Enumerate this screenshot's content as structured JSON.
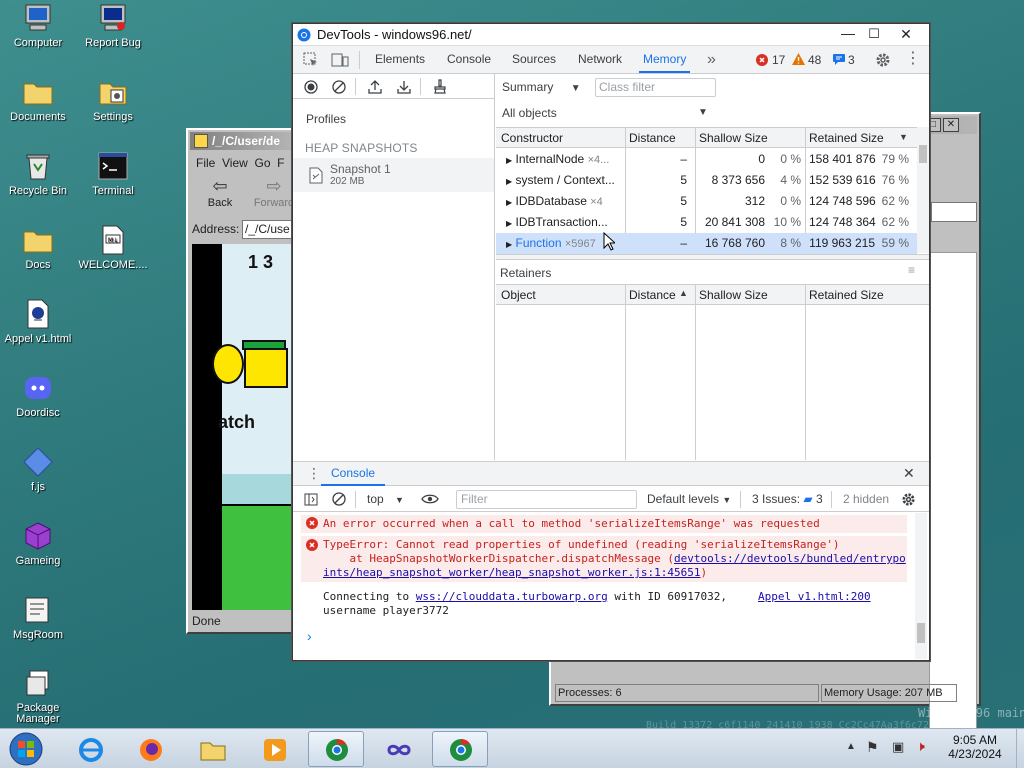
{
  "desktop": {
    "icons": [
      {
        "label": "Computer",
        "icon": "computer-icon"
      },
      {
        "label": "Report Bug",
        "icon": "report-bug-icon"
      },
      {
        "label": "Documents",
        "icon": "folder-icon"
      },
      {
        "label": "Settings",
        "icon": "settings-icon"
      },
      {
        "label": "Recycle Bin",
        "icon": "recycle-bin-icon"
      },
      {
        "label": "Terminal",
        "icon": "terminal-icon"
      },
      {
        "label": "Docs",
        "icon": "folder-icon"
      },
      {
        "label": "WELCOME....",
        "icon": "markdown-file-icon"
      },
      {
        "label": "Appel v1.html",
        "icon": "html-file-icon"
      },
      {
        "label": "Doordisc",
        "icon": "discord-icon"
      },
      {
        "label": "f.js",
        "icon": "js-file-icon"
      },
      {
        "label": "Gameing",
        "icon": "cube-icon"
      },
      {
        "label": "MsgRoom",
        "icon": "msgroom-icon"
      },
      {
        "label": "Package Manager",
        "icon": "package-icon"
      }
    ],
    "watermark": "Windows 96 main",
    "build": "Build 13372 c6f1140 241410 1938 Cc2Cc47Aa3f6c7278"
  },
  "explorer": {
    "title": "/_/C/user/de",
    "menu": [
      "File",
      "View",
      "Go",
      "F"
    ],
    "back_label": "Back",
    "forward_label": "Forward",
    "address_label": "Address:",
    "address_value": "/_/C/use",
    "status": "Done",
    "game_score": "1 3",
    "game_text": "atch"
  },
  "taskmgr": {
    "processes": "Processes: 6",
    "memory": "Memory Usage: 207 MB"
  },
  "devtools": {
    "title": "DevTools - windows96.net/",
    "tabs": [
      "Elements",
      "Console",
      "Sources",
      "Network",
      "Memory"
    ],
    "active_tab": "Memory",
    "errors": "17",
    "warnings": "48",
    "info": "3",
    "profiles_label": "Profiles",
    "heap_section": "HEAP SNAPSHOTS",
    "snapshot_name": "Snapshot 1",
    "snapshot_size": "202 MB",
    "summary_label": "Summary",
    "class_filter_placeholder": "Class filter",
    "all_objects": "All objects",
    "columns": [
      "Constructor",
      "Distance",
      "Shallow Size",
      "Retained Size"
    ],
    "rows": [
      {
        "name": "InternalNode",
        "count": "×4...",
        "distance": "–",
        "shallow": "0",
        "shallow_pct": "0 %",
        "retained": "158 401 876",
        "retained_pct": "79 %"
      },
      {
        "name": "system / Context...",
        "count": "",
        "distance": "5",
        "shallow": "8 373 656",
        "shallow_pct": "4 %",
        "retained": "152 539 616",
        "retained_pct": "76 %"
      },
      {
        "name": "IDBDatabase",
        "count": "×4",
        "distance": "5",
        "shallow": "312",
        "shallow_pct": "0 %",
        "retained": "124 748 596",
        "retained_pct": "62 %"
      },
      {
        "name": "IDBTransaction...",
        "count": "",
        "distance": "5",
        "shallow": "20 841 308",
        "shallow_pct": "10 %",
        "retained": "124 748 364",
        "retained_pct": "62 %"
      },
      {
        "name": "Function",
        "count": "×5967",
        "distance": "–",
        "shallow": "16 768 760",
        "shallow_pct": "8 %",
        "retained": "119 963 215",
        "retained_pct": "59 %"
      }
    ],
    "retainers_label": "Retainers",
    "retainer_columns": [
      "Object",
      "Distance",
      "Shallow Size",
      "Retained Size"
    ],
    "console": {
      "tab_label": "Console",
      "context": "top",
      "filter_placeholder": "Filter",
      "levels": "Default levels",
      "issues_label": "3 Issues:",
      "issues_count": "3",
      "hidden": "2 hidden",
      "messages": {
        "error1": "An error occurred when a call to method 'serializeItemsRange' was requested",
        "error2_line1": "TypeError: Cannot read properties of undefined (reading 'serializeItemsRange')",
        "error2_line2": "    at HeapSnapshotWorkerDispatcher.dispatchMessage (",
        "error2_link": "devtools://devtools/bundled/entrypoints/heap_snapshot_worker/heap_snapshot_worker.js:1:45651",
        "error2_close": ")",
        "info_pre": "Connecting to ",
        "info_link": "wss://clouddata.turbowarp.org",
        "info_post": " with ID 60917032,",
        "info_source": "Appel v1.html:200",
        "info_line2": "username player3772"
      },
      "prompt": "›"
    }
  },
  "taskbar": {
    "time": "9:05 AM",
    "date": "4/23/2024"
  }
}
